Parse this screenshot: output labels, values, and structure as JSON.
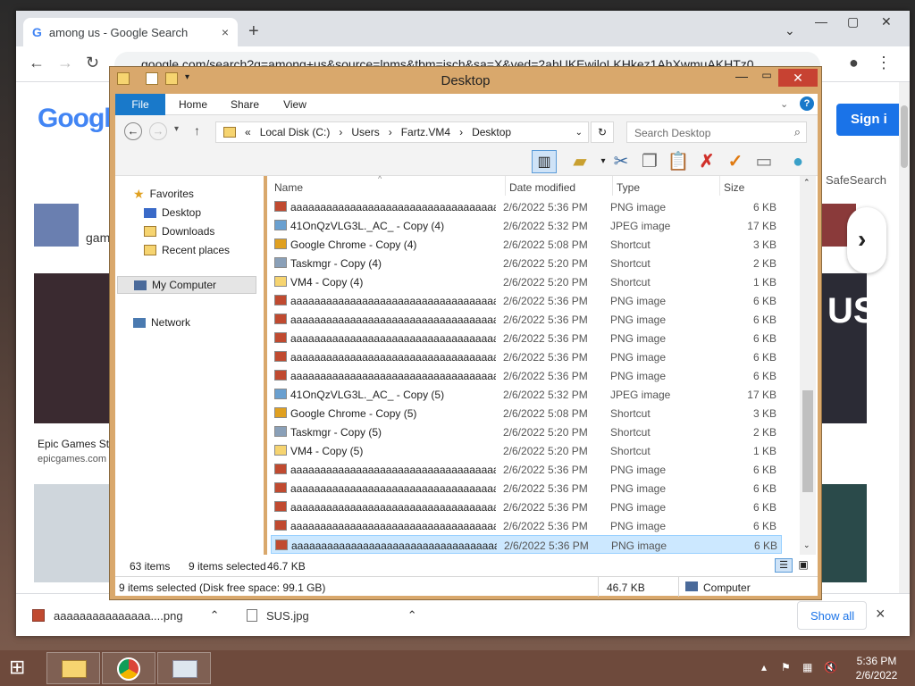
{
  "chrome": {
    "tab_title": "among us - Google Search",
    "tab_close": "×",
    "new_tab": "+",
    "omnibox_url": "google.com/search?q=among+us&source=lnms&tbm=isch&sa=X&ved=2ahUKEwiloLKHkez1AhXwmuAKHTz0",
    "google_logo": "Google",
    "sign_in": "Sign i",
    "safesearch": "SafeSearch",
    "chip_text": "gam",
    "result1_title": "Epic Games St",
    "result1_source": "epicgames.com",
    "thumb_text_right": "US"
  },
  "downloads": {
    "items": [
      "aaaaaaaaaaaaaaa....png",
      "SUS.jpg"
    ],
    "show_all": "Show all",
    "close": "×"
  },
  "explorer": {
    "title": "Desktop",
    "ribbon_tabs": [
      "File",
      "Home",
      "Share",
      "View"
    ],
    "breadcrumb": [
      "«",
      "Local Disk (C:)",
      "›",
      "Users",
      "›",
      "Fartz.VM4",
      "›",
      "Desktop"
    ],
    "search_placeholder": "Search Desktop",
    "nav": {
      "favorites": "Favorites",
      "desktop": "Desktop",
      "downloads": "Downloads",
      "recent": "Recent places",
      "my_computer": "My Computer",
      "network": "Network"
    },
    "columns": {
      "name": "Name",
      "date": "Date modified",
      "type": "Type",
      "size": "Size"
    },
    "files": [
      {
        "name": "aaaaaaaaaaaaaaaaaaaaaaaaaaaaaaaaaaaaaa...",
        "date": "2/6/2022 5:36 PM",
        "type": "PNG image",
        "size": "6 KB",
        "icon": "png-icon"
      },
      {
        "name": "41OnQzVLG3L._AC_ - Copy (4)",
        "date": "2/6/2022 5:32 PM",
        "type": "JPEG image",
        "size": "17 KB",
        "icon": "jpeg-icon"
      },
      {
        "name": "Google Chrome - Copy (4)",
        "date": "2/6/2022 5:08 PM",
        "type": "Shortcut",
        "size": "3 KB",
        "icon": "chrome-shortcut-icon"
      },
      {
        "name": "Taskmgr - Copy (4)",
        "date": "2/6/2022 5:20 PM",
        "type": "Shortcut",
        "size": "2 KB",
        "icon": "taskmgr-shortcut-icon"
      },
      {
        "name": "VM4 - Copy (4)",
        "date": "2/6/2022 5:20 PM",
        "type": "Shortcut",
        "size": "1 KB",
        "icon": "folder-shortcut-icon"
      },
      {
        "name": "aaaaaaaaaaaaaaaaaaaaaaaaaaaaaaaaaaaaaa...",
        "date": "2/6/2022 5:36 PM",
        "type": "PNG image",
        "size": "6 KB",
        "icon": "png-icon"
      },
      {
        "name": "aaaaaaaaaaaaaaaaaaaaaaaaaaaaaaaaaaaaaa...",
        "date": "2/6/2022 5:36 PM",
        "type": "PNG image",
        "size": "6 KB",
        "icon": "png-icon"
      },
      {
        "name": "aaaaaaaaaaaaaaaaaaaaaaaaaaaaaaaaaaaaaa...",
        "date": "2/6/2022 5:36 PM",
        "type": "PNG image",
        "size": "6 KB",
        "icon": "png-icon"
      },
      {
        "name": "aaaaaaaaaaaaaaaaaaaaaaaaaaaaaaaaaaaaaa...",
        "date": "2/6/2022 5:36 PM",
        "type": "PNG image",
        "size": "6 KB",
        "icon": "png-icon"
      },
      {
        "name": "aaaaaaaaaaaaaaaaaaaaaaaaaaaaaaaaaaaaaa...",
        "date": "2/6/2022 5:36 PM",
        "type": "PNG image",
        "size": "6 KB",
        "icon": "png-icon"
      },
      {
        "name": "41OnQzVLG3L._AC_ - Copy (5)",
        "date": "2/6/2022 5:32 PM",
        "type": "JPEG image",
        "size": "17 KB",
        "icon": "jpeg-icon"
      },
      {
        "name": "Google Chrome - Copy (5)",
        "date": "2/6/2022 5:08 PM",
        "type": "Shortcut",
        "size": "3 KB",
        "icon": "chrome-shortcut-icon"
      },
      {
        "name": "Taskmgr - Copy (5)",
        "date": "2/6/2022 5:20 PM",
        "type": "Shortcut",
        "size": "2 KB",
        "icon": "taskmgr-shortcut-icon"
      },
      {
        "name": "VM4 - Copy (5)",
        "date": "2/6/2022 5:20 PM",
        "type": "Shortcut",
        "size": "1 KB",
        "icon": "folder-shortcut-icon"
      },
      {
        "name": "aaaaaaaaaaaaaaaaaaaaaaaaaaaaaaaaaaaaaa...",
        "date": "2/6/2022 5:36 PM",
        "type": "PNG image",
        "size": "6 KB",
        "icon": "png-icon"
      },
      {
        "name": "aaaaaaaaaaaaaaaaaaaaaaaaaaaaaaaaaaaaaa...",
        "date": "2/6/2022 5:36 PM",
        "type": "PNG image",
        "size": "6 KB",
        "icon": "png-icon"
      },
      {
        "name": "aaaaaaaaaaaaaaaaaaaaaaaaaaaaaaaaaaaaaa...",
        "date": "2/6/2022 5:36 PM",
        "type": "PNG image",
        "size": "6 KB",
        "icon": "png-icon"
      },
      {
        "name": "aaaaaaaaaaaaaaaaaaaaaaaaaaaaaaaaaaaaaa...",
        "date": "2/6/2022 5:36 PM",
        "type": "PNG image",
        "size": "6 KB",
        "icon": "png-icon"
      },
      {
        "name": "aaaaaaaaaaaaaaaaaaaaaaaaaaaaaaaaaaaaaa...",
        "date": "2/6/2022 5:36 PM",
        "type": "PNG image",
        "size": "6 KB",
        "icon": "png-icon",
        "selected": true
      }
    ],
    "status": {
      "item_count": "63 items",
      "selected_count": "9 items selected",
      "selected_size": "46.7 KB"
    },
    "details": {
      "text": "9 items selected (Disk free space: 99.1 GB)",
      "size": "46.7 KB",
      "location": "Computer"
    }
  },
  "taskbar": {
    "time": "5:36 PM",
    "date": "2/6/2022"
  },
  "colors": {
    "explorer_frame": "#d9a86c",
    "selection": "#cce8ff",
    "ribbon_file": "#1979ca",
    "close_button": "#c74232",
    "chrome_blue": "#1a73e8"
  }
}
